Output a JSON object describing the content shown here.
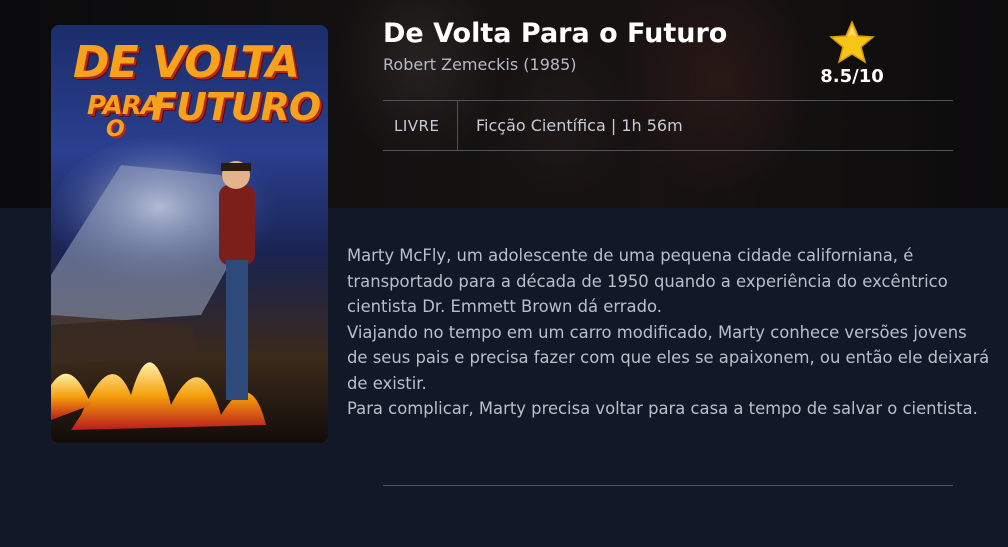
{
  "movie": {
    "title": "De Volta Para o Futuro",
    "director_year": "Robert Zemeckis (1985)",
    "rating": "8.5/10",
    "classification": "LIVRE",
    "genre_duration": "Ficção Científica | 1h 56m",
    "synopsis": "Marty McFly, um adolescente de uma pequena cidade californiana, é transportado para a década de 1950 quando a experiência do excêntrico cientista Dr. Emmett Brown dá errado.\n Viajando no tempo em um carro modificado, Marty conhece versões jovens de seus pais e precisa fazer com que eles se apaixonem, ou então ele deixará de existir.\nPara complicar, Marty precisa voltar para casa a tempo de salvar o cientista."
  },
  "poster": {
    "line1": "DE VOLTA",
    "line2": "PARA",
    "line3": "FUTURO",
    "line4": "O"
  },
  "icons": {
    "rating": "star-icon"
  },
  "colors": {
    "background": "#111827",
    "star": "#f5c518",
    "title_text": "#ffffff"
  }
}
